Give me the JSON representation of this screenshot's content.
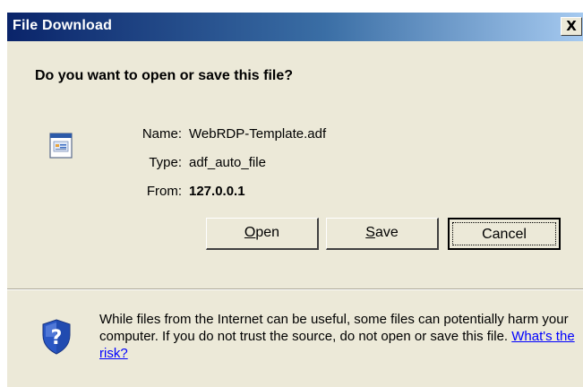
{
  "window": {
    "title": "File Download",
    "close_glyph": "X"
  },
  "prompt": {
    "question": "Do you want to open or save this file?"
  },
  "file_info": {
    "icon": "document-icon",
    "name_label": "Name:",
    "name_value": "WebRDP-Template.adf",
    "type_label": "Type:",
    "type_value": "adf_auto_file",
    "from_label": "From:",
    "from_value": "127.0.0.1"
  },
  "buttons": {
    "open": {
      "mnemonic": "O",
      "rest": "pen"
    },
    "save": {
      "mnemonic": "S",
      "rest": "ave"
    },
    "cancel": "Cancel"
  },
  "warning": {
    "icon": "shield-question-icon",
    "text": "While files from the Internet can be useful, some files can potentially harm your computer. If you do not trust the source, do not open or save this file.",
    "link": "What's the risk?"
  },
  "colors": {
    "title_bar_start": "#0a246a",
    "title_bar_end": "#a6caf0",
    "dialog_face": "#ece9d8",
    "link": "#0000ff"
  }
}
